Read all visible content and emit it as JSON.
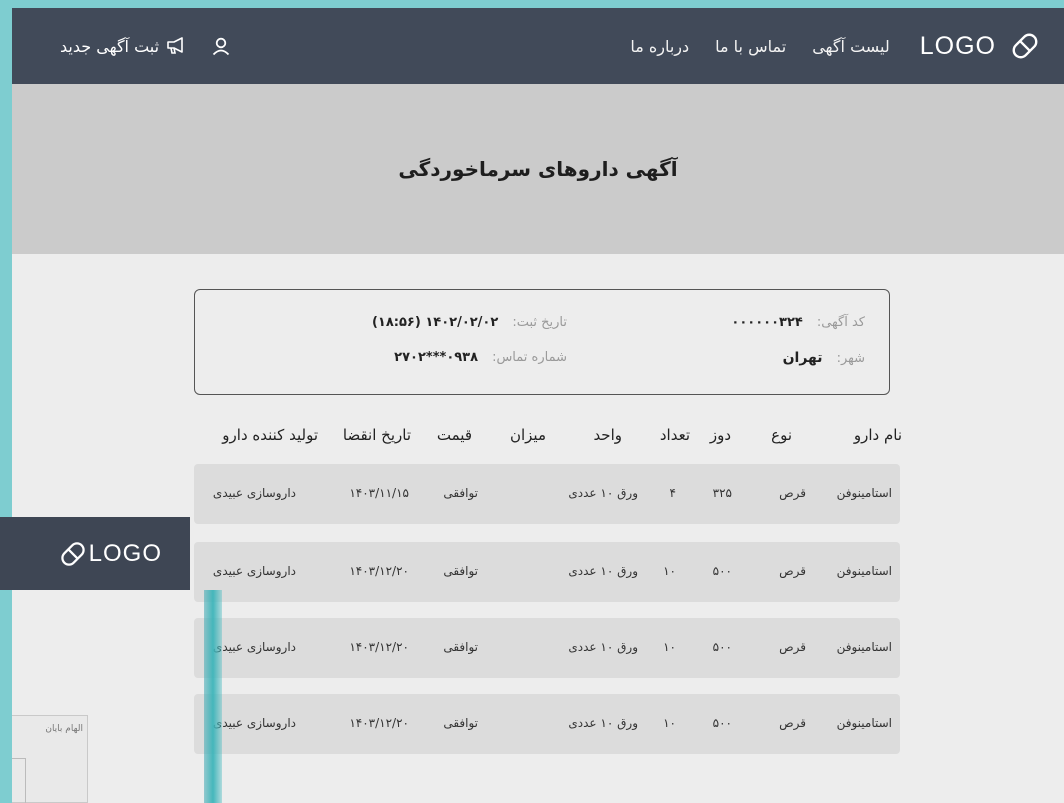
{
  "header": {
    "logo_text": "LOGO",
    "nav": [
      {
        "label": "لیست آگهی"
      },
      {
        "label": "تماس با ما"
      },
      {
        "label": "درباره ما"
      }
    ],
    "new_ad_label": "ثبت آگهی جدید"
  },
  "hero": {
    "title": "آگهی داروهای سرماخوردگی"
  },
  "info": {
    "ad_code_label": "کد آگهی:",
    "ad_code_value": "۰۰۰۰۰۰۳۲۴",
    "city_label": "شهر:",
    "city_value": "تهران",
    "date_label": "تاریخ ثبت:",
    "date_value": "۱۴۰۲/۰۲/۰۲ (۱۸:۵۶)",
    "phone_label": "شماره تماس:",
    "phone_value": "۰۹۳۸***۲۷۰۲"
  },
  "table": {
    "headers": {
      "name": "نام دارو",
      "type": "نوع",
      "dose": "دوز",
      "count": "تعداد",
      "unit": "واحد",
      "amount": "میزان",
      "price": "قیمت",
      "expiry": "تاریخ انقضا",
      "maker": "تولید کننده دارو"
    },
    "rows": [
      {
        "name": "استامینوفن",
        "type": "قرص",
        "dose": "۳۲۵",
        "count": "۴",
        "unit": "ورق ۱۰ عددی",
        "amount": "",
        "price": "توافقی",
        "expiry": "۱۴۰۳/۱۱/۱۵",
        "maker": "داروسازی عبیدی"
      },
      {
        "name": "استامینوفن",
        "type": "قرص",
        "dose": "۵۰۰",
        "count": "۱۰",
        "unit": "ورق ۱۰ عددی",
        "amount": "",
        "price": "توافقی",
        "expiry": "۱۴۰۳/۱۲/۲۰",
        "maker": "داروسازی عبیدی"
      },
      {
        "name": "استامینوفن",
        "type": "قرص",
        "dose": "۵۰۰",
        "count": "۱۰",
        "unit": "ورق ۱۰ عددی",
        "amount": "",
        "price": "توافقی",
        "expiry": "۱۴۰۳/۱۲/۲۰",
        "maker": "داروسازی عبیدی"
      },
      {
        "name": "استامینوفن",
        "type": "قرص",
        "dose": "۵۰۰",
        "count": "۱۰",
        "unit": "ورق ۱۰ عددی",
        "amount": "",
        "price": "توافقی",
        "expiry": "۱۴۰۳/۱۲/۲۰",
        "maker": "داروسازی عبیدی"
      }
    ]
  },
  "overlay": {
    "logo_text": "LOGO",
    "thumb_caption": "الهام بایان"
  },
  "colors": {
    "topbar": "#414a59",
    "hero": "#cbcbcb",
    "row_bg": "#dcdcdc",
    "accent_teal": "#7ecdd0"
  },
  "icons": {
    "logo": "pill-icon",
    "new_ad": "megaphone-icon",
    "user": "user-icon"
  }
}
